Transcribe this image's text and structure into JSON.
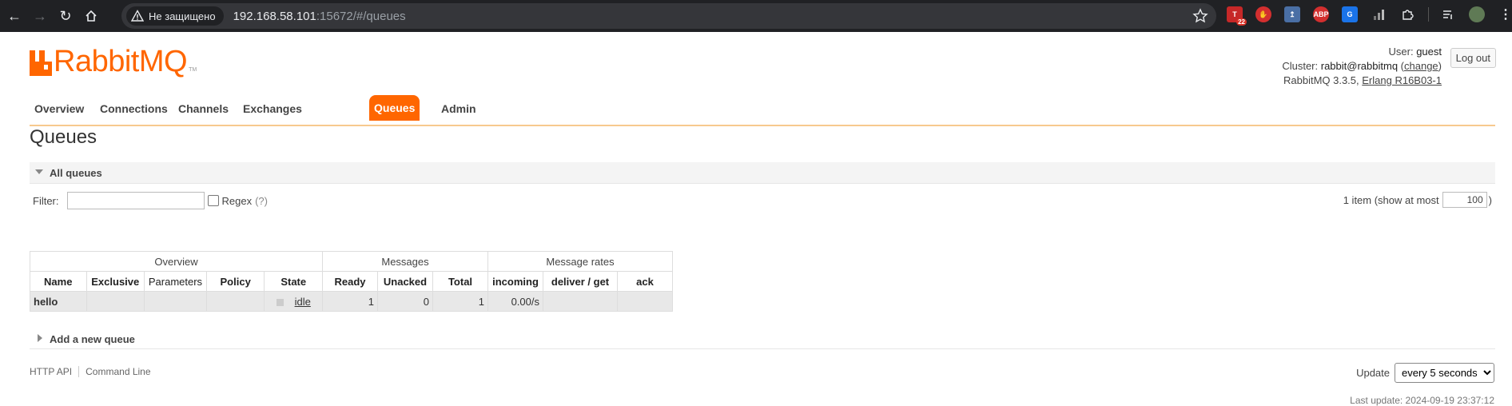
{
  "browser": {
    "security_label": "Не защищено",
    "url_host": "192.168.58.101",
    "url_rest": ":15672/#/queues",
    "ext_badge": "22",
    "ext_abp": "ABP"
  },
  "brand": {
    "name": "RabbitMQ",
    "tm": "TM"
  },
  "login": {
    "user_label": "User:",
    "user": "guest",
    "cluster_label": "Cluster:",
    "cluster": "rabbit@rabbitmq",
    "change": "change",
    "version": "RabbitMQ 3.3.5,",
    "erlang": "Erlang R16B03-1",
    "logout": "Log out"
  },
  "nav": {
    "tabs": [
      "Overview",
      "Connections",
      "Channels",
      "Exchanges",
      "Queues",
      "Admin"
    ],
    "active": "Queues"
  },
  "page_title": "Queues",
  "all_queues": {
    "label": "All queues",
    "filter_label": "Filter:",
    "regex_label": "Regex",
    "regex_help": "(?)",
    "items_text": "1 item (show at most",
    "items_max": "100",
    "items_close": ")"
  },
  "table": {
    "groups": [
      "Overview",
      "Messages",
      "Message rates"
    ],
    "columns": [
      "Name",
      "Exclusive",
      "Parameters",
      "Policy",
      "State",
      "Ready",
      "Unacked",
      "Total",
      "incoming",
      "deliver / get",
      "ack"
    ],
    "rows": [
      {
        "name": "hello",
        "exclusive": "",
        "parameters": "",
        "policy": "",
        "state": "idle",
        "ready": "1",
        "unacked": "0",
        "total": "1",
        "incoming": "0.00/s",
        "deliver_get": "",
        "ack": ""
      }
    ]
  },
  "add_queue": {
    "label": "Add a new queue"
  },
  "footer": {
    "http_api": "HTTP API",
    "command_line": "Command Line",
    "update_label": "Update",
    "update_value": "every 5 seconds",
    "last_update": "Last update: 2024-09-19 23:37:12"
  },
  "colors": {
    "accent": "#ff6600",
    "chrome": "#202124"
  }
}
